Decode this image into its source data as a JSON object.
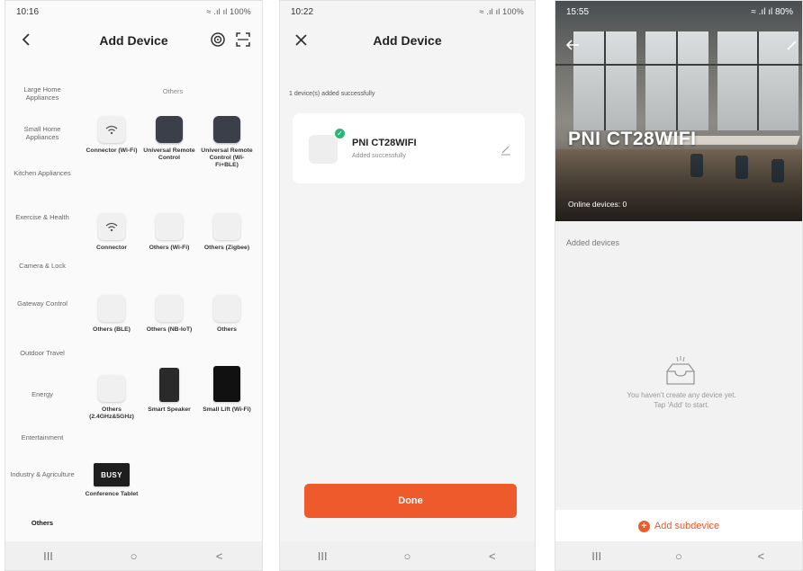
{
  "panel1": {
    "status_time": "10:16",
    "status_right": "≈ .ıl ıl 100%",
    "title": "Add Device",
    "group_title": "Others",
    "categories": [
      "Large Home Appliances",
      "Small Home Appliances",
      "Kitchen Appliances",
      "Exercise & Health",
      "Camera & Lock",
      "Gateway Control",
      "Outdoor Travel",
      "Energy",
      "Entertainment",
      "Industry & Agriculture",
      "Others"
    ],
    "devices": [
      "Connector (Wi-Fi)",
      "Universal Remote Control",
      "Universal Remote Control (Wi-Fi+BLE)",
      "Connector",
      "Others (Wi-Fi)",
      "Others (Zigbee)",
      "Others (BLE)",
      "Others (NB-IoT)",
      "Others",
      "Others (2.4GHz&5GHz)",
      "Smart Speaker",
      "Small Lift (Wi-Fi)",
      "Conference Tablet"
    ],
    "busy_text": "BUSY"
  },
  "panel2": {
    "status_time": "10:22",
    "status_right": "≈ .ıl ıl 100%",
    "title": "Add Device",
    "success_msg": "1 device(s) added successfully",
    "device_name": "PNI CT28WIFI",
    "device_status": "Added successfully",
    "done_label": "Done"
  },
  "panel3": {
    "status_time": "15:55",
    "status_right": "≈ .ıl ıl 80%",
    "hero_name": "PNI CT28WIFI",
    "online": "Online devices: 0",
    "added_label": "Added devices",
    "empty_line1": "You haven't create any device yet.",
    "empty_line2": "Tap 'Add' to start.",
    "add_sub": "Add subdevice"
  },
  "nav": {
    "recent": "III",
    "home": "○",
    "back": "<"
  },
  "colors": {
    "accent": "#ee5a2c",
    "check": "#2eb37a"
  }
}
